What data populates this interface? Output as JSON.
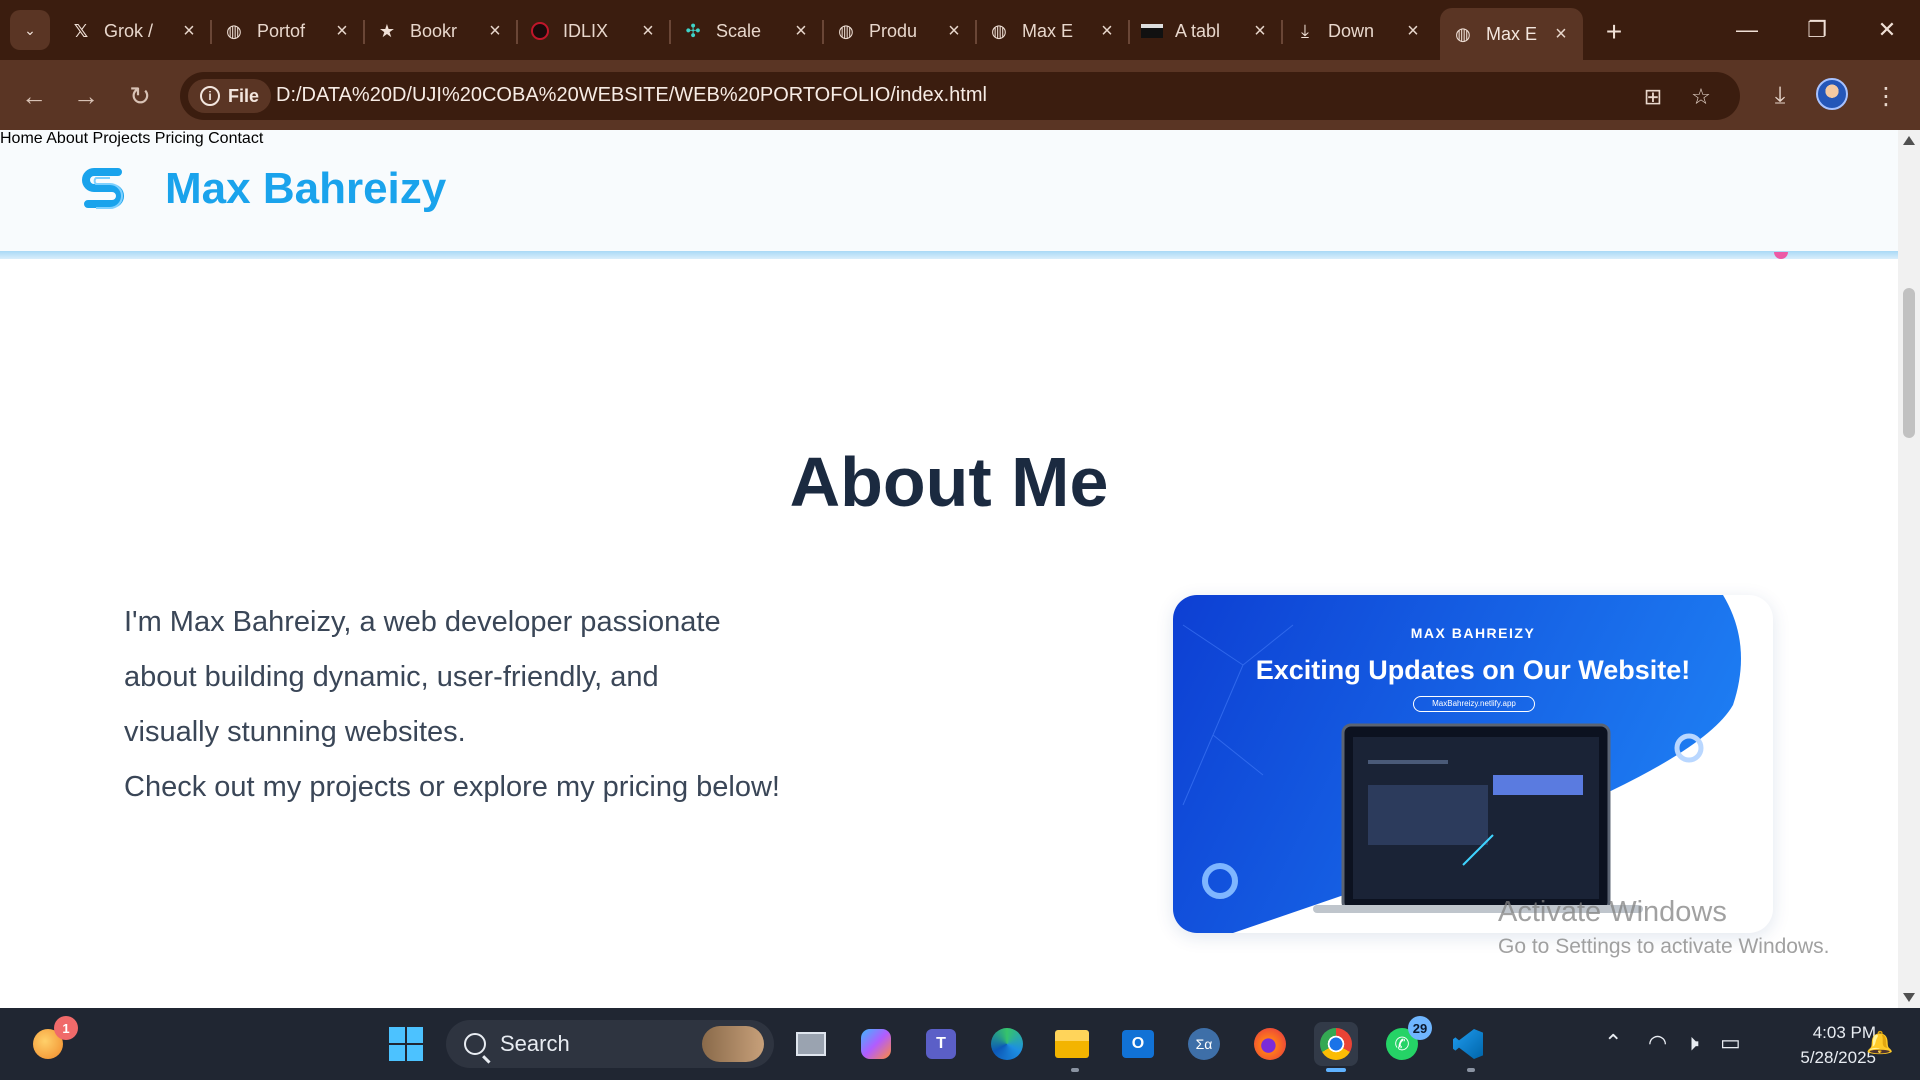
{
  "browser": {
    "tabs": [
      {
        "title": "Grok /",
        "icon": "x-logo-icon"
      },
      {
        "title": "Portof",
        "icon": "globe-icon"
      },
      {
        "title": "Bookr",
        "icon": "star-icon"
      },
      {
        "title": "IDLIX",
        "icon": "idlix-icon"
      },
      {
        "title": "Scale",
        "icon": "scale-icon"
      },
      {
        "title": "Produ",
        "icon": "globe-icon"
      },
      {
        "title": "Max E",
        "icon": "globe-icon"
      },
      {
        "title": "A tabl",
        "icon": "table-icon"
      },
      {
        "title": "Down",
        "icon": "download-icon"
      },
      {
        "title": "Max E",
        "icon": "globe-icon",
        "active": true
      }
    ],
    "security_chip": "File",
    "url": "D:/DATA%20D/UJI%20COBA%20WEBSITE/WEB%20PORTOFOLIO/index.html"
  },
  "site": {
    "brand": "Max Bahreizy",
    "nav": [
      "Home",
      "About",
      "Projects",
      "Pricing",
      "Contact"
    ],
    "about": {
      "title": "About Me",
      "lines": [
        "I'm Max Bahreizy, a web developer passionate",
        "about building dynamic, user-friendly, and",
        "visually stunning websites.",
        "Check out my projects or explore my pricing below!"
      ]
    },
    "card": {
      "brand": "MAX BAHREIZY",
      "title": "Exciting Updates on Our Website!",
      "url": "MaxBahreizy.netlify.app"
    }
  },
  "watermark": {
    "line1": "Activate Windows",
    "line2": "Go to Settings to activate Windows."
  },
  "taskbar": {
    "search_label": "Search",
    "weather_badge": "1",
    "whatsapp_badge": "29",
    "time": "4:03 PM",
    "date": "5/28/2025"
  },
  "colors": {
    "brand": "#1aa3ec",
    "heading": "#1b2a40",
    "chrome_dark": "#3b1d0f",
    "chrome_light": "#5a3524"
  }
}
